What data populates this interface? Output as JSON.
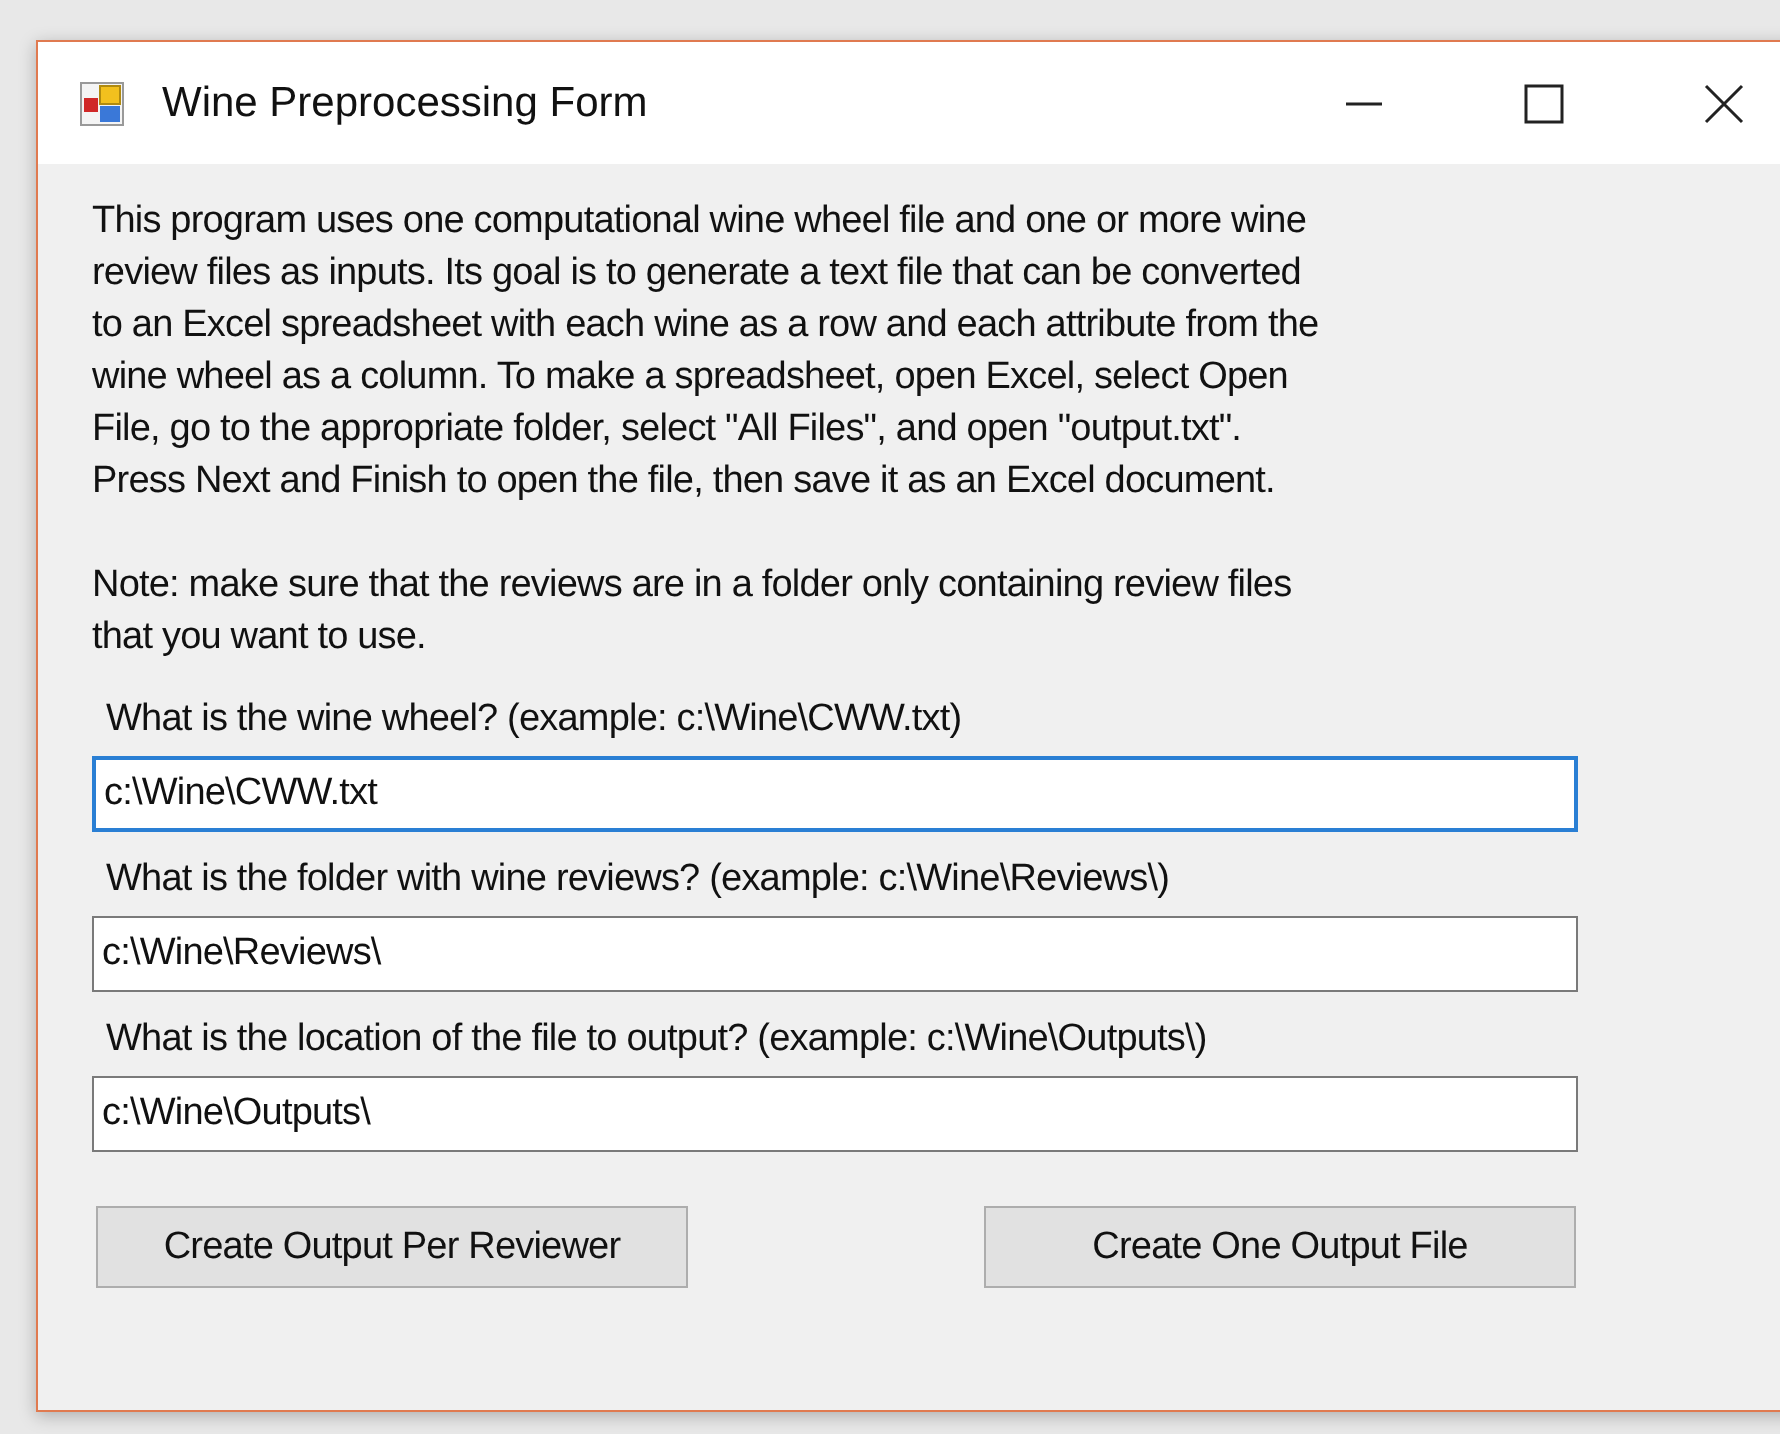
{
  "window": {
    "title": "Wine Preprocessing Form"
  },
  "intro": [
    "This program uses one computational wine wheel file and one or more wine",
    "review files as inputs. Its goal is to generate a text file that can be converted",
    "to an Excel spreadsheet with each wine as a row and each attribute from the",
    "wine wheel as a column. To make a spreadsheet, open Excel, select Open",
    "File, go to the appropriate folder, select \"All Files\", and open \"output.txt\".",
    "Press Next and Finish to open the file, then save it as an Excel document."
  ],
  "note": [
    "Note: make sure that the reviews are in a folder only containing review files",
    "that you want to use."
  ],
  "fields": [
    {
      "label": "What is the wine wheel? (example: c:\\Wine\\CWW.txt)",
      "value": "c:\\Wine\\CWW.txt",
      "focused": true
    },
    {
      "label": "What is the folder with wine reviews? (example: c:\\Wine\\Reviews\\)",
      "value": "c:\\Wine\\Reviews\\",
      "focused": false
    },
    {
      "label": "What is the location of the file to output? (example: c:\\Wine\\Outputs\\)",
      "value": "c:\\Wine\\Outputs\\",
      "focused": false
    }
  ],
  "buttons": [
    "Create Output Per Reviewer",
    "Create One Output File"
  ]
}
